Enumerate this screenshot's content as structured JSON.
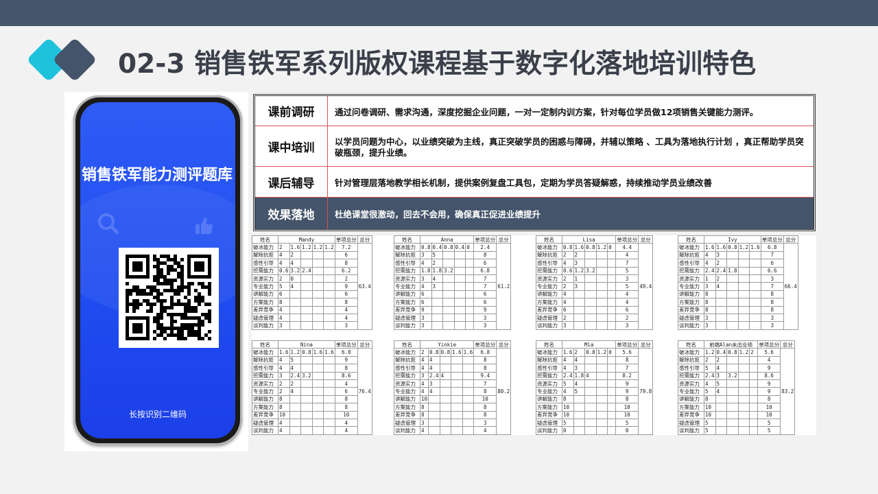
{
  "page": {
    "title": "02-3 销售铁军系列版权课程基于数字化落地培训特色"
  },
  "phone": {
    "screen_title": "销售铁军能力测评题库",
    "qr_hint": "长按识别二维码"
  },
  "info_rows": [
    {
      "label": "课前调研",
      "text": "通过问卷调研、需求沟通，深度挖掘企业问题，一对一定制内训方案，针对每位学员做12项销售关键能力测评。"
    },
    {
      "label": "课中培训",
      "text": "以学员问题为中心，以业绩突破为主线，真正突破学员的困惑与障碍，并辅以策略 、工具为落地执行计划 ，真正帮助学员突破瓶颈，提升业绩。"
    },
    {
      "label": "课后辅导",
      "text": "针对管理层落地教学相长机制，提供案例复盘工具包，定期为学员答疑解惑，持续推动学员业绩改善"
    },
    {
      "label": "效果落地",
      "text": "杜绝课堂很激动，回去不会用，确保真正促进业绩提升"
    }
  ],
  "score_header": {
    "name": "姓名",
    "subtotal": "单项总分",
    "total": "总分"
  },
  "skills": [
    "破冰能力",
    "解除抗拒",
    "感性引导",
    "挖需能力",
    "资源实力",
    "专业能力",
    "讲解能力",
    "方案能力",
    "差异竞争",
    "疑虑管理",
    "谈判能力"
  ],
  "sheets": [
    {
      "name": "Mandy",
      "total": "63.4",
      "rows": [
        [
          "2",
          "1.6",
          "1.2",
          "1.2",
          "1.2",
          "7.2"
        ],
        [
          "4",
          "2",
          "",
          "",
          "",
          "6"
        ],
        [
          "4",
          "4",
          "",
          "",
          "",
          "8"
        ],
        [
          "0.6",
          "3.2",
          "2.4",
          "",
          "",
          "6.2"
        ],
        [
          "2",
          "0",
          "",
          "",
          "",
          "2"
        ],
        [
          "5",
          "4",
          "",
          "",
          "",
          "9"
        ],
        [
          "6",
          "",
          "",
          "",
          "",
          "6"
        ],
        [
          "8",
          "",
          "",
          "",
          "",
          "8"
        ],
        [
          "4",
          "",
          "",
          "",
          "",
          "4"
        ],
        [
          "4",
          "",
          "",
          "",
          "",
          "4"
        ],
        [
          "3",
          "",
          "",
          "",
          "",
          "3"
        ]
      ]
    },
    {
      "name": "Anna",
      "total": "61.2",
      "rows": [
        [
          "0.8",
          "0.4",
          "0.8",
          "0.4",
          "0",
          "2.4"
        ],
        [
          "3",
          "5",
          "",
          "",
          "",
          "8"
        ],
        [
          "4",
          "2",
          "",
          "",
          "",
          "6"
        ],
        [
          "1.8",
          "1.8",
          "3.2",
          "",
          "",
          "6.8"
        ],
        [
          "3",
          "4",
          "",
          "",
          "",
          "7"
        ],
        [
          "4",
          "3",
          "",
          "",
          "",
          "7"
        ],
        [
          "6",
          "",
          "",
          "",
          "",
          "6"
        ],
        [
          "6",
          "",
          "",
          "",
          "",
          "6"
        ],
        [
          "9",
          "",
          "",
          "",
          "",
          "9"
        ],
        [
          "3",
          "",
          "",
          "",
          "",
          "3"
        ],
        [
          "3",
          "",
          "",
          "",
          "",
          "3"
        ]
      ]
    },
    {
      "name": "Lisa",
      "total": "49.4",
      "rows": [
        [
          "0.8",
          "1.6",
          "0.8",
          "1.2",
          "0",
          "4.4"
        ],
        [
          "2",
          "2",
          "",
          "",
          "",
          "4"
        ],
        [
          "4",
          "3",
          "",
          "",
          "",
          "7"
        ],
        [
          "0.6",
          "1.2",
          "3.2",
          "",
          "",
          "5"
        ],
        [
          "2",
          "1",
          "",
          "",
          "",
          "3"
        ],
        [
          "2",
          "3",
          "",
          "",
          "",
          "5"
        ],
        [
          "4",
          "",
          "",
          "",
          "",
          "4"
        ],
        [
          "4",
          "",
          "",
          "",
          "",
          "4"
        ],
        [
          "6",
          "",
          "",
          "",
          "",
          "6"
        ],
        [
          "2",
          "",
          "",
          "",
          "",
          "2"
        ],
        [
          "3",
          "",
          "",
          "",
          "",
          "3"
        ]
      ]
    },
    {
      "name": "Ivy",
      "total": "66.4",
      "rows": [
        [
          "1.6",
          "1.6",
          "0.8",
          "1.2",
          "1.6",
          "6.8"
        ],
        [
          "4",
          "3",
          "",
          "",
          "",
          "7"
        ],
        [
          "4",
          "2",
          "",
          "",
          "",
          "6"
        ],
        [
          "2.4",
          "2.4",
          "1.8",
          "",
          "",
          "6.6"
        ],
        [
          "1",
          "2",
          "",
          "",
          "",
          "3"
        ],
        [
          "3",
          "4",
          "",
          "",
          "",
          "7"
        ],
        [
          "8",
          "",
          "",
          "",
          "",
          "8"
        ],
        [
          "8",
          "",
          "",
          "",
          "",
          "8"
        ],
        [
          "8",
          "",
          "",
          "",
          "",
          "8"
        ],
        [
          "3",
          "",
          "",
          "",
          "",
          "3"
        ],
        [
          "3",
          "",
          "",
          "",
          "",
          "3"
        ]
      ]
    },
    {
      "name": "Nina",
      "total": "76.4",
      "rows": [
        [
          "1.6",
          "1.2",
          "0.8",
          "1.6",
          "1.6",
          "6.8"
        ],
        [
          "4",
          "5",
          "",
          "",
          "",
          "9"
        ],
        [
          "4",
          "4",
          "",
          "",
          "",
          "8"
        ],
        [
          "3",
          "2.4",
          "3.2",
          "",
          "",
          "8.6"
        ],
        [
          "2",
          "2",
          "",
          "",
          "",
          "4"
        ],
        [
          "2",
          "4",
          "",
          "",
          "",
          "6"
        ],
        [
          "8",
          "",
          "",
          "",
          "",
          "8"
        ],
        [
          "8",
          "",
          "",
          "",
          "",
          "8"
        ],
        [
          "10",
          "",
          "",
          "",
          "",
          "10"
        ],
        [
          "4",
          "",
          "",
          "",
          "",
          "4"
        ],
        [
          "4",
          "",
          "",
          "",
          "",
          "4"
        ]
      ]
    },
    {
      "name": "Yinkie",
      "total": "80.2",
      "rows": [
        [
          "2",
          "0.8",
          "0.8",
          "1.6",
          "1.6",
          "6.8"
        ],
        [
          "4",
          "4",
          "",
          "",
          "",
          "8"
        ],
        [
          "4",
          "4",
          "",
          "",
          "",
          "8"
        ],
        [
          "3",
          "2.4",
          "4",
          "",
          "",
          "9.4"
        ],
        [
          "4",
          "3",
          "",
          "",
          "",
          "7"
        ],
        [
          "4",
          "4",
          "",
          "",
          "",
          "8"
        ],
        [
          "10",
          "",
          "",
          "",
          "",
          "10"
        ],
        [
          "8",
          "",
          "",
          "",
          "",
          "8"
        ],
        [
          "8",
          "",
          "",
          "",
          "",
          "8"
        ],
        [
          "3",
          "",
          "",
          "",
          "",
          "3"
        ],
        [
          "4",
          "",
          "",
          "",
          "",
          "4"
        ]
      ]
    },
    {
      "name": "Mia",
      "total": "79.8",
      "rows": [
        [
          "1.6",
          "2",
          "0.8",
          "1.2",
          "0",
          "5.6"
        ],
        [
          "4",
          "4",
          "",
          "",
          "",
          "8"
        ],
        [
          "4",
          "3",
          "",
          "",
          "",
          "7"
        ],
        [
          "2.4",
          "1.8",
          "4",
          "",
          "",
          "8.2"
        ],
        [
          "5",
          "4",
          "",
          "",
          "",
          "9"
        ],
        [
          "4",
          "5",
          "",
          "",
          "",
          "9"
        ],
        [
          "8",
          "",
          "",
          "",
          "",
          "8"
        ],
        [
          "10",
          "",
          "",
          "",
          "",
          "10"
        ],
        [
          "10",
          "",
          "",
          "",
          "",
          "10"
        ],
        [
          "5",
          "",
          "",
          "",
          "",
          "5"
        ],
        [
          "0",
          "",
          "",
          "",
          "",
          "0"
        ]
      ]
    },
    {
      "name": "前端Alan未出业绩",
      "total": "83.2",
      "rows": [
        [
          "1.2",
          "0.4",
          "0.8",
          "1.2",
          "2",
          "5.6"
        ],
        [
          "2",
          "2",
          "",
          "",
          "",
          "4"
        ],
        [
          "5",
          "4",
          "",
          "",
          "",
          "9"
        ],
        [
          "2.4",
          "3",
          "3.2",
          "",
          "",
          "8.6"
        ],
        [
          "4",
          "5",
          "",
          "",
          "",
          "9"
        ],
        [
          "5",
          "4",
          "",
          "",
          "",
          "9"
        ],
        [
          "8",
          "",
          "",
          "",
          "",
          "8"
        ],
        [
          "10",
          "",
          "",
          "",
          "",
          "10"
        ],
        [
          "10",
          "",
          "",
          "",
          "",
          "10"
        ],
        [
          "5",
          "",
          "",
          "",
          "",
          "5"
        ],
        [
          "5",
          "",
          "",
          "",
          "",
          "5"
        ]
      ]
    }
  ],
  "colors": {
    "topbar": "#44546a",
    "accent": "#1fc2dc",
    "phone_screen": "#2050f2",
    "divider": "#d9534f"
  }
}
